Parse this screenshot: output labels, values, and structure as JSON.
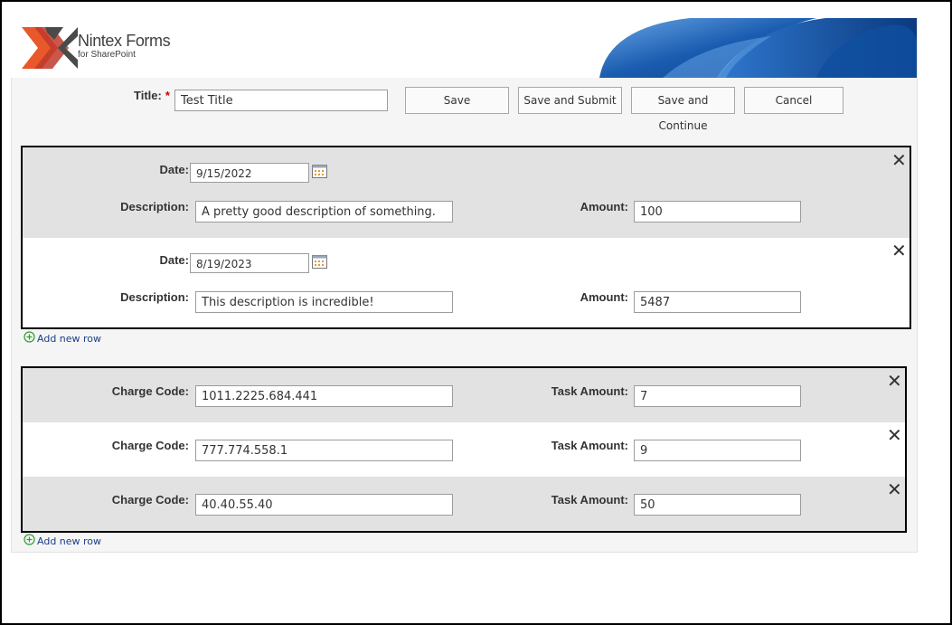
{
  "header": {
    "logo_title": "Nintex Forms",
    "logo_subtitle": "for SharePoint"
  },
  "title_field": {
    "label": "Title:",
    "required_marker": "*",
    "value": "Test Title"
  },
  "buttons": {
    "save": "Save",
    "save_submit": "Save and Submit",
    "save_continue": "Save and Continue",
    "cancel": "Cancel"
  },
  "expenses": {
    "rows": [
      {
        "date_label": "Date:",
        "date": "9/15/2022",
        "description_label": "Description:",
        "description": "A pretty good description of something.",
        "amount_label": "Amount:",
        "amount": "100"
      },
      {
        "date_label": "Date:",
        "date": "8/19/2023",
        "description_label": "Description:",
        "description": "This description is incredible!",
        "amount_label": "Amount:",
        "amount": "5487"
      }
    ],
    "add_row": "Add new row"
  },
  "charges": {
    "rows": [
      {
        "code_label": "Charge Code:",
        "code": "1011.2225.684.441",
        "task_label": "Task Amount:",
        "task_amount": "7"
      },
      {
        "code_label": "Charge Code:",
        "code": "777.774.558.1",
        "task_label": "Task Amount:",
        "task_amount": "9"
      },
      {
        "code_label": "Charge Code:",
        "code": "40.40.55.40",
        "task_label": "Task Amount:",
        "task_amount": "50"
      }
    ],
    "add_row": "Add new row"
  },
  "icons": {
    "delete": "close-icon",
    "date_picker": "calendar-icon",
    "add": "plus-circle-icon"
  },
  "delete_glyph": "✕",
  "colors": {
    "required": "#cc0000",
    "link": "#1a3f8a",
    "add_icon": "#2e9e2e",
    "row_alt": "#e2e2e2",
    "logo_orange": "#e8582a",
    "logo_grey": "#4a4a4a",
    "banner_blue": "#1a5cb0"
  }
}
